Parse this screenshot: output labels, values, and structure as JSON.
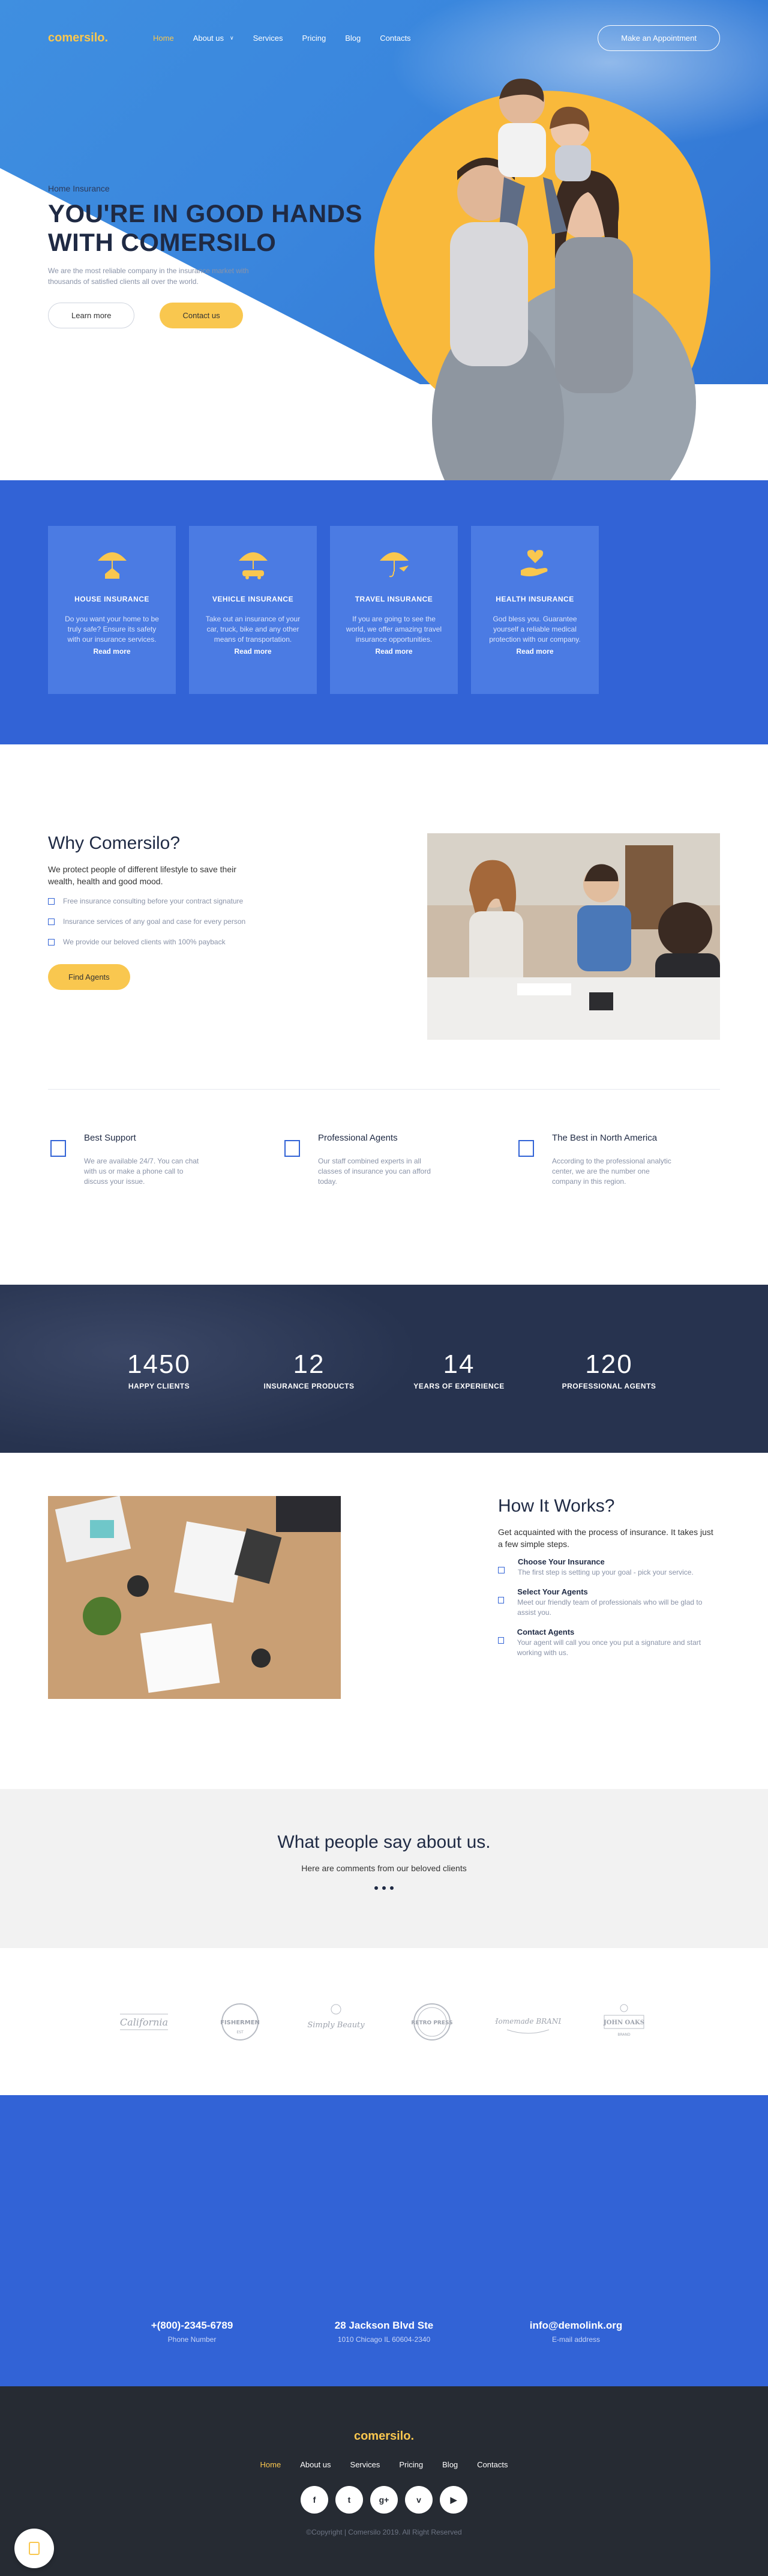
{
  "brand": {
    "logo": "comersilo."
  },
  "nav": {
    "items": [
      "Home",
      "About us",
      "Services",
      "Pricing",
      "Blog",
      "Contacts"
    ],
    "dropdown_icon": "chevron-down-icon",
    "cta": "Make an Appointment"
  },
  "hero": {
    "kicker": "Home Insurance",
    "title_line1": "YOU'RE IN GOOD HANDS",
    "title_line2": "WITH COMERSILO",
    "lead": "We are the most reliable company in the insurance market with thousands of satisfied clients all over the world.",
    "btn_learn": "Learn more",
    "btn_contact": "Contact us",
    "colors": {
      "blue": "#3263d6",
      "yellow": "#f9c74f",
      "navy": "#1f2a44"
    }
  },
  "services": [
    {
      "icon": "umbrella-house-icon",
      "title": "HOUSE INSURANCE",
      "text": "Do you want your home to be truly safe? Ensure its safety with our insurance services.",
      "link": "Read more"
    },
    {
      "icon": "umbrella-car-icon",
      "title": "VEHICLE INSURANCE",
      "text": "Take out an insurance of your car, truck, bike and any other means of transportation.",
      "link": "Read more"
    },
    {
      "icon": "umbrella-plane-icon",
      "title": "TRAVEL INSURANCE",
      "text": "If you are going to see the world, we offer amazing travel insurance opportunities.",
      "link": "Read more"
    },
    {
      "icon": "hand-heart-icon",
      "title": "HEALTH INSURANCE",
      "text": "God bless you. Guarantee yourself a reliable medical protection with our company.",
      "link": "Read more"
    }
  ],
  "why": {
    "title": "Why Comersilo?",
    "sub": "We protect people of different lifestyle to save their wealth, health and good mood.",
    "list": [
      "Free insurance consulting before your contract signature",
      "Insurance services of any goal and case for every person",
      "We provide our beloved clients with 100% payback"
    ],
    "button": "Find Agents"
  },
  "features": [
    {
      "title": "Best Support",
      "text": "We are available 24/7. You can chat with us or make a phone call to discuss your issue."
    },
    {
      "title": "Professional Agents",
      "text": "Our staff combined experts in all classes of insurance you can afford today."
    },
    {
      "title": "The Best in North America",
      "text": "According to the professional analytic center, we are the number one company in this region."
    }
  ],
  "stats": [
    {
      "n": "1450",
      "l": "HAPPY CLIENTS"
    },
    {
      "n": "12",
      "l": "INSURANCE PRODUCTS"
    },
    {
      "n": "14",
      "l": "YEARS OF EXPERIENCE"
    },
    {
      "n": "120",
      "l": "PROFESSIONAL AGENTS"
    }
  ],
  "how": {
    "title": "How It Works?",
    "sub": "Get acquainted with the process of insurance. It takes just a few simple steps.",
    "steps": [
      {
        "title": "Choose Your Insurance",
        "text": "The first step is setting up your goal - pick your service."
      },
      {
        "title": "Select Your Agents",
        "text": "Meet our friendly team of professionals who will be glad to assist you."
      },
      {
        "title": "Contact Agents",
        "text": "Your agent will call you once you put a signature and start working with us."
      }
    ]
  },
  "testimonials": {
    "title": "What people say about us.",
    "sub": "Here are comments from our beloved clients"
  },
  "brands": {
    "items": [
      "California",
      "FISHERMEN",
      "Simply Beauty",
      "RETRO PRESS",
      "Homemade BRAND",
      "JOHN OAKS"
    ],
    "sub": [
      "",
      "EST",
      "",
      "",
      "",
      "BRAND"
    ]
  },
  "contact": [
    {
      "v": "+(800)-2345-6789",
      "k": "Phone Number"
    },
    {
      "v": "28 Jackson Blvd Ste",
      "k": "1010 Chicago IL 60604-2340"
    },
    {
      "v": "info@demolink.org",
      "k": "E-mail address"
    }
  ],
  "footer": {
    "logo": "comersilo.",
    "nav": [
      "Home",
      "About us",
      "Services",
      "Pricing",
      "Blog",
      "Contacts"
    ],
    "social": [
      {
        "icon": "facebook-icon",
        "glyph": "f"
      },
      {
        "icon": "twitter-icon",
        "glyph": "t"
      },
      {
        "icon": "google-plus-icon",
        "glyph": "g+"
      },
      {
        "icon": "vimeo-icon",
        "glyph": "v"
      },
      {
        "icon": "youtube-icon",
        "glyph": "▶"
      }
    ],
    "copy": "©Copyright | Comersilo 2019. All Right Reserved"
  }
}
